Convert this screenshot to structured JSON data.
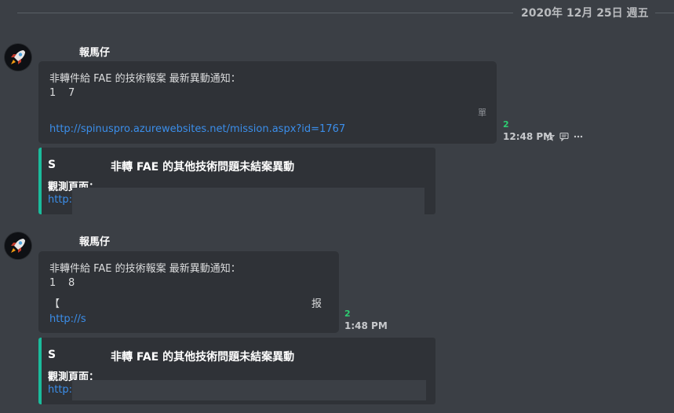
{
  "divider": {
    "date": "2020年 12月 25日 週五"
  },
  "messages": [
    {
      "author": "報馬仔",
      "line1": "非轉件給 FAE 的技術報案 最新異動通知：",
      "line2a": "1",
      "line2b": "7",
      "tail_char": "單",
      "link": "http://spinuspro.azurewebsites.net/mission.aspx?id=1767",
      "read_count": "2",
      "time": "12:48 PM",
      "actions": [
        "star-icon",
        "comment-icon",
        "more-icon"
      ],
      "embed": {
        "s_char": "S",
        "title": "非轉 FAE 的其他技術問題未結案異動",
        "field_name": "觀測頁面：",
        "link_prefix": "http:/"
      }
    },
    {
      "author": "報馬仔",
      "line1": "非轉件給 FAE 的技術報案 最新異動通知：",
      "line2a": "1",
      "line2b": "8",
      "line3a": "【",
      "line3b": "报",
      "link_prefix": "http://s",
      "read_count": "2",
      "time": "1:48 PM",
      "embed": {
        "s_char": "S",
        "title": "非轉 FAE 的其他技術問題未結案異動",
        "field_name": "觀測頁面：",
        "link_prefix": "http:/"
      }
    }
  ]
}
